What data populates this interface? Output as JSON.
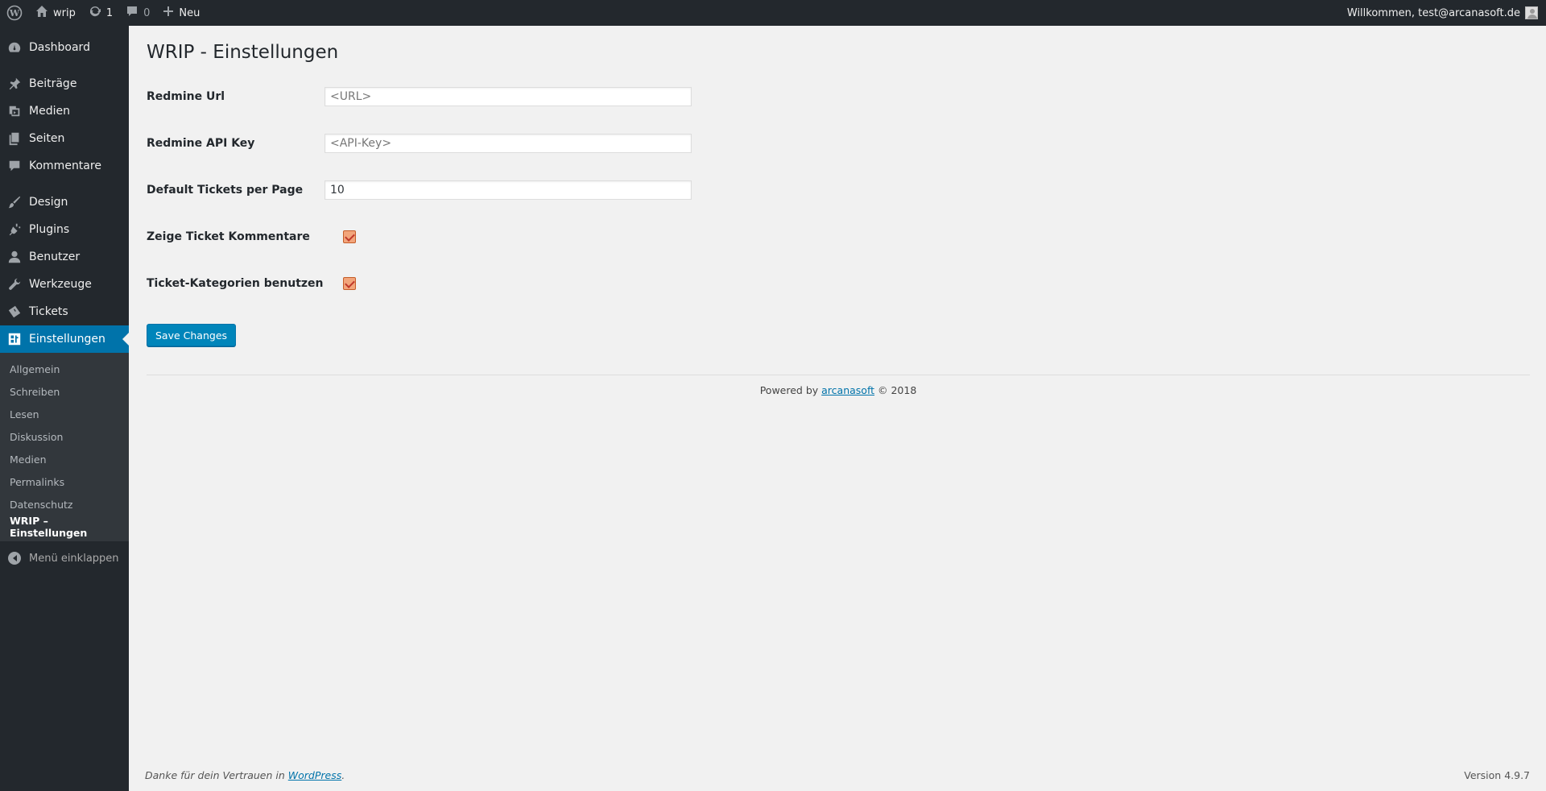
{
  "adminbar": {
    "site_name": "wrip",
    "updates_count": "1",
    "comments_count": "0",
    "new_label": "Neu",
    "welcome": "Willkommen, test@arcanasoft.de"
  },
  "sidebar": {
    "items": [
      {
        "label": "Dashboard",
        "icon": "dashboard-icon"
      },
      {
        "label": "Beiträge",
        "icon": "pin-icon"
      },
      {
        "label": "Medien",
        "icon": "media-icon"
      },
      {
        "label": "Seiten",
        "icon": "pages-icon"
      },
      {
        "label": "Kommentare",
        "icon": "comment-icon"
      },
      {
        "label": "Design",
        "icon": "brush-icon"
      },
      {
        "label": "Plugins",
        "icon": "plugin-icon"
      },
      {
        "label": "Benutzer",
        "icon": "user-icon"
      },
      {
        "label": "Werkzeuge",
        "icon": "wrench-icon"
      },
      {
        "label": "Tickets",
        "icon": "ticket-icon"
      },
      {
        "label": "Einstellungen",
        "icon": "settings-icon"
      }
    ],
    "submenu": [
      "Allgemein",
      "Schreiben",
      "Lesen",
      "Diskussion",
      "Medien",
      "Permalinks",
      "Datenschutz",
      "WRIP – Einstellungen"
    ],
    "collapse_label": "Menü einklappen"
  },
  "main": {
    "title": "WRIP - Einstellungen",
    "fields": {
      "redmine_url": {
        "label": "Redmine Url",
        "placeholder": "<URL>",
        "value": ""
      },
      "api_key": {
        "label": "Redmine API Key",
        "placeholder": "<API-Key>",
        "value": ""
      },
      "tickets_per_page": {
        "label": "Default Tickets per Page",
        "value": "10"
      },
      "show_comments": {
        "label": "Zeige Ticket Kommentare",
        "checked": true
      },
      "use_categories": {
        "label": "Ticket-Kategorien benutzen",
        "checked": true
      }
    },
    "save_label": "Save Changes",
    "powered_prefix": "Powered by ",
    "powered_link": "arcanasoft",
    "powered_suffix": " © 2018"
  },
  "footer": {
    "thanks_prefix": "Danke für dein Vertrauen in ",
    "thanks_link": "WordPress",
    "thanks_suffix": ".",
    "version": "Version 4.9.7"
  },
  "colors": {
    "admin_dark": "#23282d",
    "accent": "#0073aa",
    "button": "#0085ba",
    "checkbox": "#f2a57b"
  }
}
